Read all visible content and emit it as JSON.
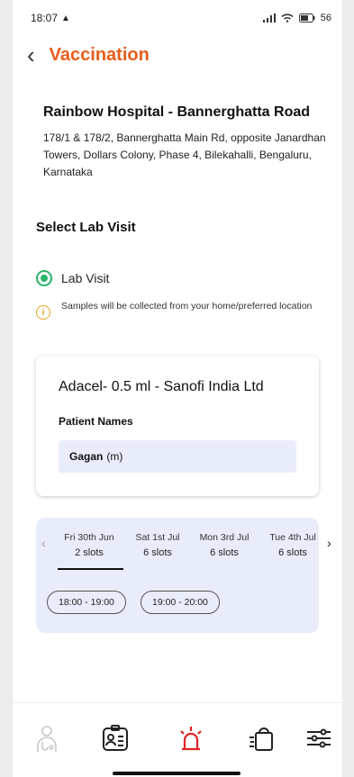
{
  "status": {
    "time": "18:07",
    "battery": "56"
  },
  "header": {
    "title": "Vaccination"
  },
  "hospital": {
    "name": "Rainbow Hospital - Bannerghatta Road",
    "address": "178/1 & 178/2, Bannerghatta Main Rd, opposite Janardhan Towers, Dollars Colony, Phase 4, Bilekahalli, Bengaluru, Karnataka"
  },
  "visit": {
    "section_title": "Select Lab Visit",
    "option_label": "Lab Visit",
    "info_text": "Samples will be collected from your home/preferred location"
  },
  "card": {
    "vaccine": "Adacel- 0.5 ml - Sanofi India Ltd",
    "patient_label": "Patient Names",
    "patient_name": "Gagan",
    "patient_suffix": "(m)"
  },
  "slots": {
    "days": [
      {
        "date": "Fri 30th Jun",
        "slots": "2 slots"
      },
      {
        "date": "Sat 1st Jul",
        "slots": "6 slots"
      },
      {
        "date": "Mon 3rd Jul",
        "slots": "6 slots"
      },
      {
        "date": "Tue 4th Jul",
        "slots": "6 slots"
      }
    ],
    "times": [
      "18:00 - 19:00",
      "19:00 - 20:00"
    ]
  },
  "colors": {
    "accent": "#e85d1a",
    "radio": "#2ab36a",
    "alert": "#e02424",
    "slot_bg": "#e9edfb"
  },
  "nav_icons": [
    "doctor-icon",
    "id-card-icon",
    "emergency-siren-icon",
    "shopping-bag-icon",
    "filter-sliders-icon"
  ]
}
